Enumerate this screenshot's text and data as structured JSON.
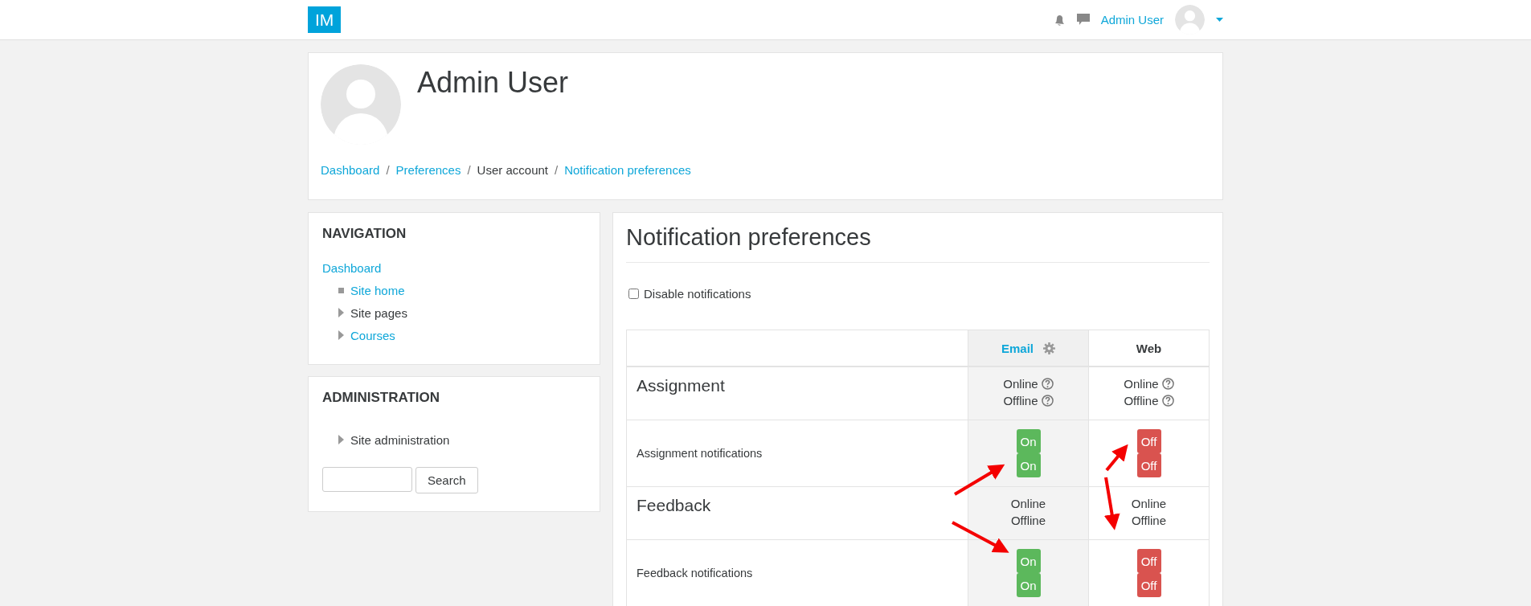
{
  "navbar": {
    "logo": "IM",
    "user_name": "Admin User"
  },
  "profile": {
    "name": "Admin User",
    "separator": "/",
    "breadcrumb": [
      {
        "label": "Dashboard",
        "link": true
      },
      {
        "label": "Preferences",
        "link": true
      },
      {
        "label": "User account",
        "link": false
      },
      {
        "label": "Notification preferences",
        "link": true
      }
    ]
  },
  "navigation": {
    "title": "NAVIGATION",
    "items": [
      {
        "label": "Dashboard",
        "link": true,
        "children": [
          {
            "label": "Site home",
            "link": true,
            "kind": "leaf"
          },
          {
            "label": "Site pages",
            "link": false,
            "kind": "branch"
          },
          {
            "label": "Courses",
            "link": true,
            "kind": "branch"
          }
        ]
      }
    ]
  },
  "administration": {
    "title": "ADMINISTRATION",
    "items": [
      {
        "label": "Site administration",
        "link": false,
        "kind": "branch"
      }
    ],
    "search_button": "Search"
  },
  "main": {
    "title": "Notification preferences",
    "disable_notifications": {
      "label": "Disable notifications",
      "checked": false
    },
    "table": {
      "columns": [
        {
          "label": "Email",
          "link": true,
          "settings": true,
          "highlighted": true
        },
        {
          "label": "Web",
          "link": false,
          "settings": false,
          "highlighted": false
        }
      ],
      "rows": [
        {
          "kind": "component",
          "name": "Assignment",
          "cells": [
            {
              "states": [
                {
                  "label": "Online",
                  "help": true
                },
                {
                  "label": "Offline",
                  "help": true
                }
              ]
            },
            {
              "states": [
                {
                  "label": "Online",
                  "help": true
                },
                {
                  "label": "Offline",
                  "help": true
                }
              ]
            }
          ]
        },
        {
          "kind": "setting",
          "name": "Assignment notifications",
          "cells": [
            {
              "toggles": [
                {
                  "label": "On",
                  "on": true
                },
                {
                  "label": "On",
                  "on": true
                }
              ]
            },
            {
              "toggles": [
                {
                  "label": "Off",
                  "on": false
                },
                {
                  "label": "Off",
                  "on": false
                }
              ]
            }
          ]
        },
        {
          "kind": "component",
          "name": "Feedback",
          "cells": [
            {
              "states": [
                {
                  "label": "Online",
                  "help": false
                },
                {
                  "label": "Offline",
                  "help": false
                }
              ]
            },
            {
              "states": [
                {
                  "label": "Online",
                  "help": false
                },
                {
                  "label": "Offline",
                  "help": false
                }
              ]
            }
          ]
        },
        {
          "kind": "setting",
          "name": "Feedback notifications",
          "cells": [
            {
              "toggles": [
                {
                  "label": "On",
                  "on": true
                },
                {
                  "label": "On",
                  "on": true
                }
              ]
            },
            {
              "toggles": [
                {
                  "label": "Off",
                  "on": false
                },
                {
                  "label": "Off",
                  "on": false
                }
              ]
            }
          ]
        }
      ]
    }
  }
}
